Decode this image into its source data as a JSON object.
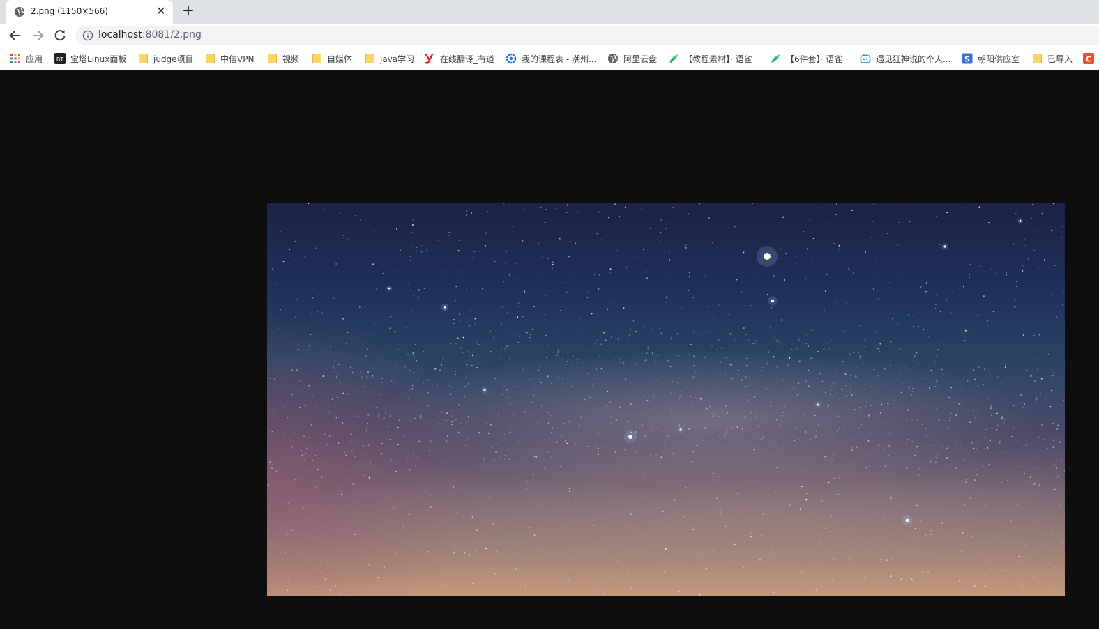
{
  "tab": {
    "title": "2.png (1150×566)",
    "close_glyph": "✕",
    "new_tab_glyph": "+",
    "favicon": "globe-icon"
  },
  "toolbar": {
    "back_icon": "arrow-left-icon",
    "forward_icon": "arrow-right-icon",
    "reload_icon": "reload-icon",
    "url_host": "localhost",
    "url_rest": ":8081/2.png",
    "site_info_icon": "info-icon"
  },
  "bookmarks": [
    {
      "label": "应用",
      "icon": "apps-grid-icon"
    },
    {
      "label": "宝塔Linux面板",
      "icon": "bt-icon"
    },
    {
      "label": "judge项目",
      "icon": "folder-icon"
    },
    {
      "label": "中信VPN",
      "icon": "folder-icon"
    },
    {
      "label": "视频",
      "icon": "folder-icon"
    },
    {
      "label": "自媒体",
      "icon": "folder-icon"
    },
    {
      "label": "java学习",
      "icon": "folder-icon"
    },
    {
      "label": "在线翻译_有道",
      "icon": "youdao-icon"
    },
    {
      "label": "我的课程表 - 潮州...",
      "icon": "gear-icon"
    },
    {
      "label": "阿里云盘",
      "icon": "globe-icon"
    },
    {
      "label": "【教程素材】· 语雀",
      "icon": "yuque-icon"
    },
    {
      "label": "【6件套】· 语雀",
      "icon": "yuque-icon"
    },
    {
      "label": "遇见狂神说的个人...",
      "icon": "bilibili-icon"
    },
    {
      "label": "朝阳供应室",
      "icon": "s-icon"
    },
    {
      "label": "已导入",
      "icon": "folder-icon"
    },
    {
      "label": "",
      "icon": "c-icon"
    }
  ],
  "content": {
    "image": "starry-sky-milky-way-image"
  }
}
